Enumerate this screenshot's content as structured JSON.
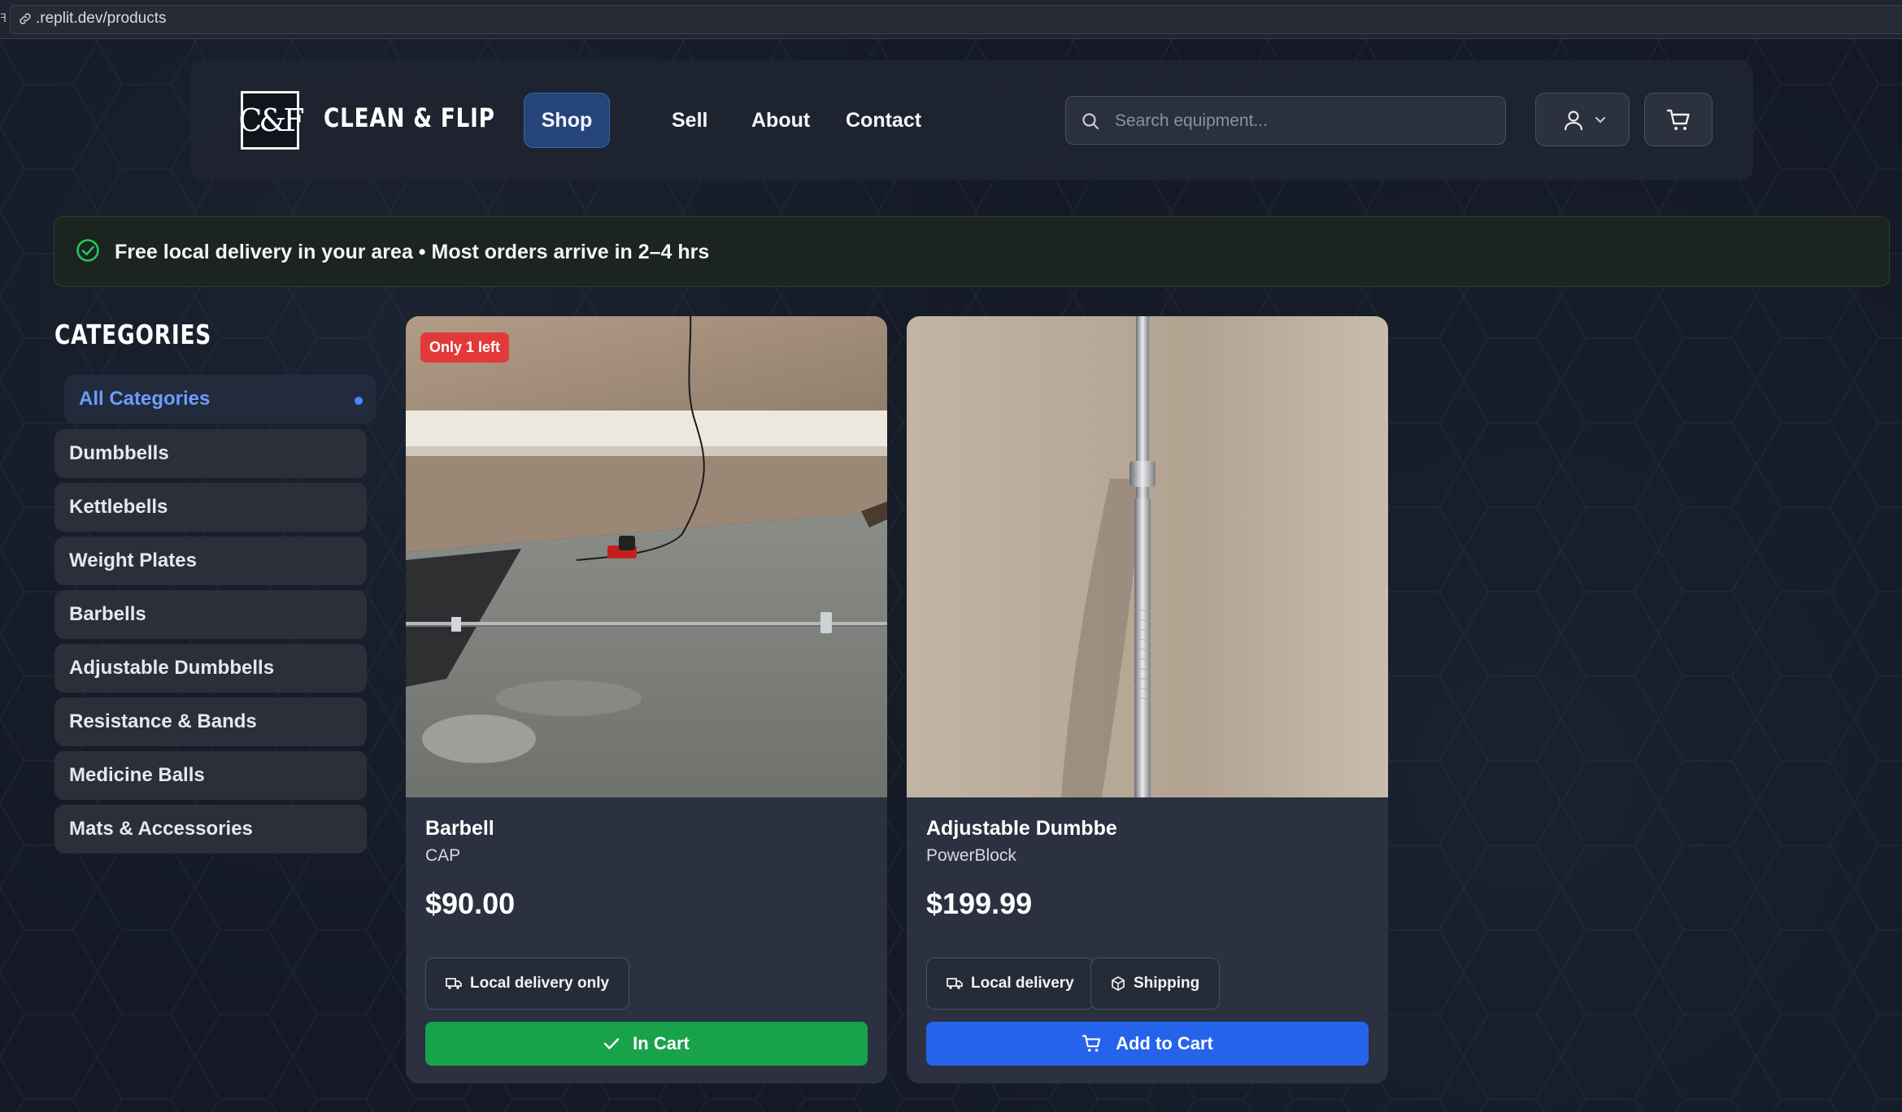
{
  "browser": {
    "url": ".replit.dev/products"
  },
  "header": {
    "brand": "CLEAN & FLIP",
    "logo_text": "C&F",
    "nav": {
      "shop": "Shop",
      "sell": "Sell",
      "about": "About",
      "contact": "Contact"
    },
    "search_placeholder": "Search equipment..."
  },
  "banner": {
    "text": "Free local delivery in your area • Most orders arrive in 2–4 hrs"
  },
  "sidebar": {
    "title": "CATEGORIES",
    "items": [
      {
        "label": "All Categories",
        "active": true
      },
      {
        "label": "Dumbbells"
      },
      {
        "label": "Kettlebells"
      },
      {
        "label": "Weight Plates"
      },
      {
        "label": "Barbells"
      },
      {
        "label": "Adjustable Dumbbells"
      },
      {
        "label": "Resistance & Bands"
      },
      {
        "label": "Medicine Balls"
      },
      {
        "label": "Mats & Accessories"
      }
    ]
  },
  "products": [
    {
      "badge": "Only 1 left",
      "name": "Barbell",
      "brand": "CAP",
      "price": "$90.00",
      "chips": [
        "Local delivery only"
      ],
      "action": "In Cart"
    },
    {
      "name": "Adjustable Dumbbe",
      "brand": "PowerBlock",
      "price": "$199.99",
      "chips": [
        "Local delivery",
        "Shipping"
      ],
      "action": "Add to Cart"
    }
  ],
  "colors": {
    "accent_blue": "#2563eb",
    "accent_green": "#18a34a",
    "badge_red": "#e23a3a",
    "active_category": "#6d9cff"
  }
}
